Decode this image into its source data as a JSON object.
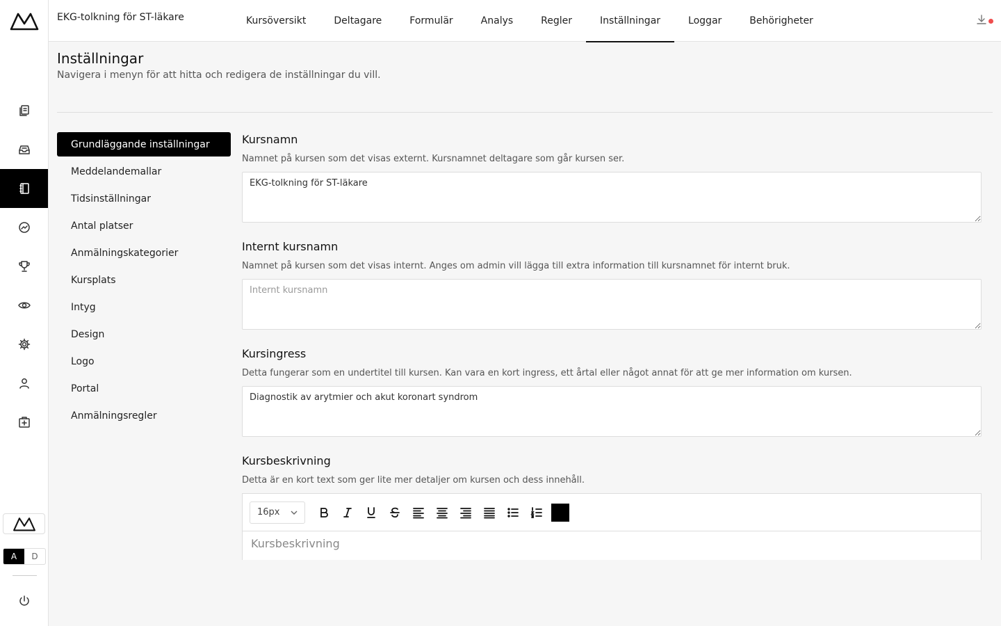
{
  "header": {
    "course_title": "EKG-tolkning för ST-läkare",
    "tabs": [
      {
        "label": "Kursöversikt",
        "active": false
      },
      {
        "label": "Deltagare",
        "active": false
      },
      {
        "label": "Formulär",
        "active": false
      },
      {
        "label": "Analys",
        "active": false
      },
      {
        "label": "Regler",
        "active": false
      },
      {
        "label": "Inställningar",
        "active": true
      },
      {
        "label": "Loggar",
        "active": false
      },
      {
        "label": "Behörigheter",
        "active": false
      }
    ],
    "download_icon": "download-icon",
    "notification_color": "#ef4d4d"
  },
  "rail": {
    "icons": [
      "documents-icon",
      "inbox-icon",
      "notebook-icon",
      "analytics-icon",
      "trophy-icon",
      "eye-icon",
      "gear-icon",
      "user-icon",
      "add-box-icon"
    ],
    "active_index": 2,
    "mode": {
      "a_label": "A",
      "d_label": "D",
      "selected": "A"
    },
    "power_icon": "power-icon"
  },
  "page": {
    "title": "Inställningar",
    "subtitle": "Navigera i menyn för att hitta och redigera de inställningar du vill."
  },
  "menu": {
    "items": [
      {
        "label": "Grundläggande inställningar",
        "active": true
      },
      {
        "label": "Meddelandemallar",
        "active": false
      },
      {
        "label": "Tidsinställningar",
        "active": false
      },
      {
        "label": "Antal platser",
        "active": false
      },
      {
        "label": "Anmälningskategorier",
        "active": false
      },
      {
        "label": "Kursplats",
        "active": false
      },
      {
        "label": "Intyg",
        "active": false
      },
      {
        "label": "Design",
        "active": false
      },
      {
        "label": "Logo",
        "active": false
      },
      {
        "label": "Portal",
        "active": false
      },
      {
        "label": "Anmälningsregler",
        "active": false
      }
    ]
  },
  "fields": {
    "kursnamn": {
      "label": "Kursnamn",
      "description": "Namnet på kursen som det visas externt. Kursnamnet deltagare som går kursen ser.",
      "value": "EKG-tolkning för ST-läkare",
      "placeholder": ""
    },
    "internt": {
      "label": "Internt kursnamn",
      "description": "Namnet på kursen som det visas internt. Anges om admin vill lägga till extra information till kursnamnet för internt bruk.",
      "value": "",
      "placeholder": "Internt kursnamn"
    },
    "ingress": {
      "label": "Kursingress",
      "description": "Detta fungerar som en undertitel till kursen. Kan vara en kort ingress, ett årtal eller något annat för att ge mer information om kursen.",
      "value": "Diagnostik av arytmier och akut koronart syndrom",
      "placeholder": ""
    },
    "beskrivning": {
      "label": "Kursbeskrivning",
      "description": "Detta är en kort text som ger lite mer detaljer om kursen och dess innehåll.",
      "placeholder": "Kursbeskrivning",
      "font_size": "16px",
      "color_swatch": "#000000"
    }
  }
}
